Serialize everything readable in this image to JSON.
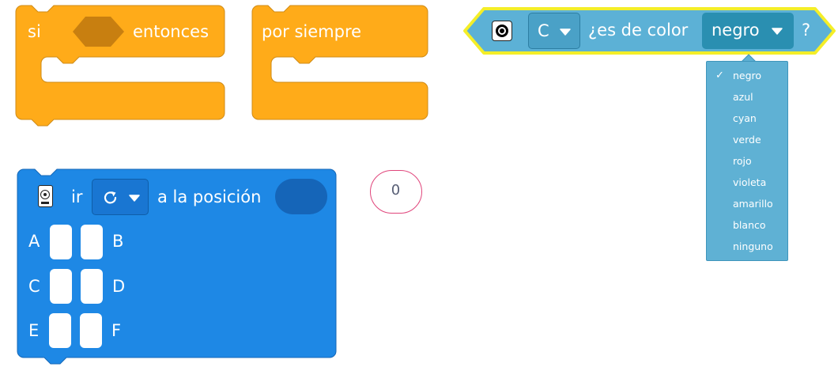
{
  "blocks": {
    "if_then": {
      "if_label": "si",
      "then_label": "entonces",
      "color": "#ffab19"
    },
    "forever": {
      "label": "por siempre",
      "color": "#ffab19"
    },
    "color_sensor": {
      "port": "C",
      "question": "¿es de color",
      "selected_color": "negro",
      "question_mark": "?",
      "color": "#5cb1d6",
      "outline": "#f4ee28",
      "sensor_icon": "color-sensor-icon",
      "dropdown_icon": "triangle-down-icon"
    },
    "motor_position": {
      "verb": "ir",
      "direction_icon": "rotate-clockwise-icon",
      "position_label": "a la posición",
      "ports": [
        "A",
        "B",
        "C",
        "D",
        "E",
        "F"
      ],
      "color": "#1e88e5",
      "motor_icon": "motor-icon"
    },
    "reporter_value": "0"
  },
  "color_menu": {
    "options": [
      "negro",
      "azul",
      "cyan",
      "verde",
      "rojo",
      "violeta",
      "amarillo",
      "blanco",
      "ninguno"
    ],
    "selected": "negro",
    "check_mark": "✓"
  }
}
